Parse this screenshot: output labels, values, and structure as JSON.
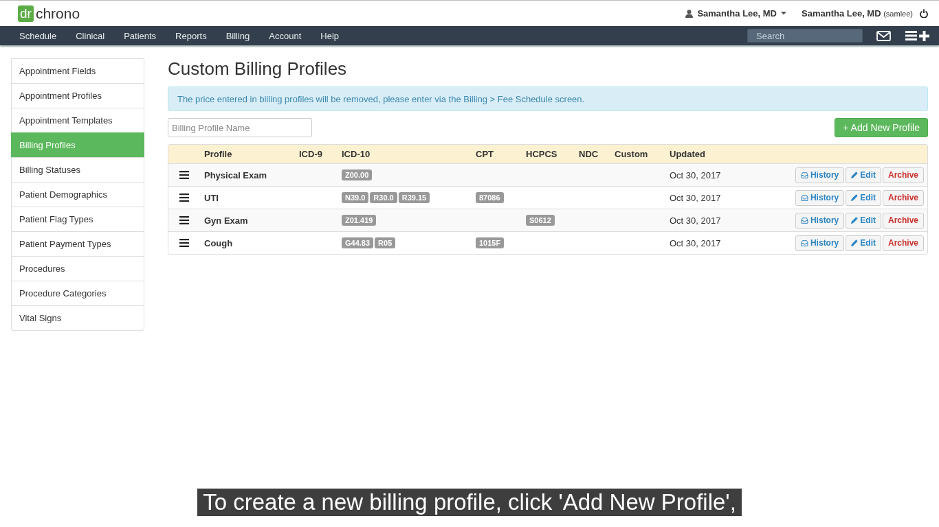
{
  "logo": {
    "mark": "dr",
    "name": "chrono"
  },
  "user_menu": {
    "label": "Samantha Lee, MD"
  },
  "account": {
    "name": "Samantha Lee, MD",
    "username": "(samlee)"
  },
  "nav": {
    "items": [
      "Schedule",
      "Clinical",
      "Patients",
      "Reports",
      "Billing",
      "Account",
      "Help"
    ],
    "search": {
      "placeholder": "Search"
    }
  },
  "sidebar": {
    "items": [
      {
        "label": "Appointment Fields",
        "selected": false
      },
      {
        "label": "Appointment Profiles",
        "selected": false
      },
      {
        "label": "Appointment Templates",
        "selected": false
      },
      {
        "label": "Billing Profiles",
        "selected": true
      },
      {
        "label": "Billing Statuses",
        "selected": false
      },
      {
        "label": "Patient Demographics",
        "selected": false
      },
      {
        "label": "Patient Flag Types",
        "selected": false
      },
      {
        "label": "Patient Payment Types",
        "selected": false
      },
      {
        "label": "Procedures",
        "selected": false
      },
      {
        "label": "Procedure Categories",
        "selected": false
      },
      {
        "label": "Vital Signs",
        "selected": false
      }
    ]
  },
  "page": {
    "title": "Custom Billing Profiles",
    "notice": "The price entered in billing profiles will be removed, please enter via the Billing > Fee Schedule screen.",
    "filter": {
      "placeholder": "Billing Profile Name"
    },
    "add_button": "+ Add New Profile"
  },
  "table": {
    "columns": [
      "Profile",
      "ICD-9",
      "ICD-10",
      "CPT",
      "HCPCS",
      "NDC",
      "Custom",
      "Updated"
    ],
    "rows": [
      {
        "profile": "Physical Exam",
        "icd10": [
          "Z00.00"
        ],
        "updated": "Oct 30, 2017",
        "actions": [
          "History",
          "Edit",
          "Archive"
        ]
      },
      {
        "profile": "UTI",
        "icd10": [
          "N39.0",
          "R30.0",
          "R39.15"
        ],
        "cpt": [
          "87086"
        ],
        "updated": "Oct 30, 2017",
        "actions": [
          "History",
          "Edit",
          "Archive"
        ]
      },
      {
        "profile": "Gyn Exam",
        "icd10": [
          "Z01.419"
        ],
        "hcpcs": [
          "S0612"
        ],
        "updated": "Oct 30, 2017",
        "actions": [
          "History",
          "Edit",
          "Archive"
        ]
      },
      {
        "profile": "Cough",
        "icd10": [
          "G44.83",
          "R05"
        ],
        "cpt": [
          "1015F"
        ],
        "updated": "Oct 30, 2017",
        "actions": [
          "History",
          "Edit",
          "Archive"
        ]
      }
    ]
  },
  "caption": "To create a new billing profile, click 'Add New Profile',"
}
